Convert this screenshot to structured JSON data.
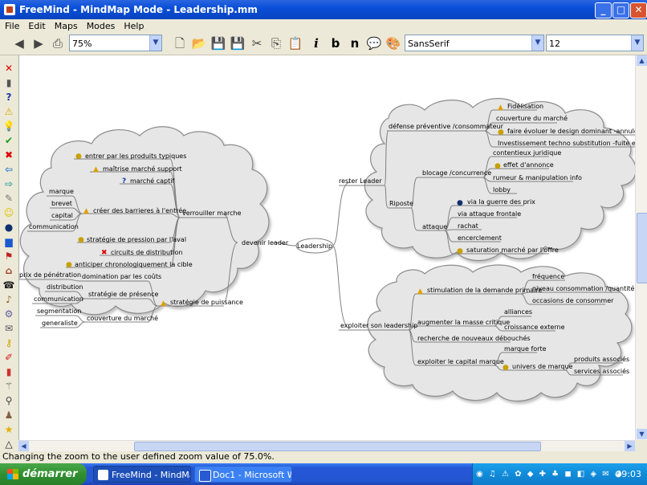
{
  "window": {
    "title": "FreeMind - MindMap Mode - Leadership.mm"
  },
  "menu": [
    "File",
    "Edit",
    "Maps",
    "Modes",
    "Help"
  ],
  "toolbar": {
    "zoom_value": "75%",
    "font_family": "SansSerif",
    "font_size": "12",
    "italic_label": "i",
    "bold_label": "b",
    "normal_label": "n"
  },
  "status": {
    "text": "Changing the zoom to the user defined zoom value of 75.0%."
  },
  "taskbar": {
    "start_label": "démarrer",
    "tasks": [
      "FreeMind - MindMap ...",
      "Doc1 - Microsoft Word"
    ],
    "clock": "09:03"
  },
  "mindmap": {
    "root": "Leadership",
    "nodes": {
      "devenir_leader": "devenir leader",
      "verrouiller": "verrouiller marche",
      "strategie_puissance": "stratégie de puissance",
      "entrer": "entrer par les produits typiques",
      "maitrise": "maîtrise marché support",
      "captif": "marché captif",
      "barrieres": "créer des barrieres à l'entrée",
      "marque": "marque",
      "brevet": "brevet",
      "capital": "capital",
      "communication_v": "communication",
      "pression": "stratégie de pression par l'aval",
      "circuits": "circuits de distribution",
      "anticiper": "anticiper chronologiquement la cible",
      "domination": "domination par les coûts",
      "prix": "prix de pénétration",
      "presence": "stratégie de présence",
      "distribution": "distribution",
      "communication_p": "communication",
      "couverture_gauche": "couverture du marché",
      "segmentation": "segmentation",
      "generaliste": "generaliste",
      "rester_leader": "rester Leader",
      "defense": "défense préventive /consommateur",
      "fidelisation": "Fidélisation",
      "couverture_droite": "couverture du marché",
      "faire_evoluer": "faire évoluer le design dominant -annuler av con",
      "investissement": "Investissement techno substitution -fuite en avant",
      "riposte": "Riposte",
      "blocage": "blocage /concurrence",
      "contentieux": "contentieux juridique",
      "effet": "effet d'annonce",
      "rumeur": "rumeur & manipulation info",
      "lobby": "lobby",
      "attaque": "attaque",
      "guerre_prix": "via la guerre des prix",
      "attaque_frontale": "via attaque frontale",
      "rachat": "rachat",
      "encerclement": "encerclement",
      "saturation": "saturation marché par l'offre",
      "exploiter_leadership": "exploiter son leadership",
      "stimulation": "stimulation de la demande primaire",
      "frequence": "fréquence",
      "niveau": "niveau consommation /quantité",
      "occasions": "occasions de consommer",
      "masse_critique": "augmenter la masse critique",
      "alliances": "alliances",
      "croissance": "croissance externe",
      "recherche": "recherche de nouveaux débouchés",
      "capital_marque": "exploiter le capital marque",
      "marque_forte": "marque forte",
      "univers": "univers de marque",
      "produits_associes": "produits associés",
      "services_associes": "services associés"
    }
  },
  "colors": {
    "cloud_fill": "#e6e6e6",
    "cloud_stroke": "#8c8c8c",
    "edge": "#808080",
    "title_blue": "#0a4fd8",
    "start_green": "#3a9a3a"
  }
}
